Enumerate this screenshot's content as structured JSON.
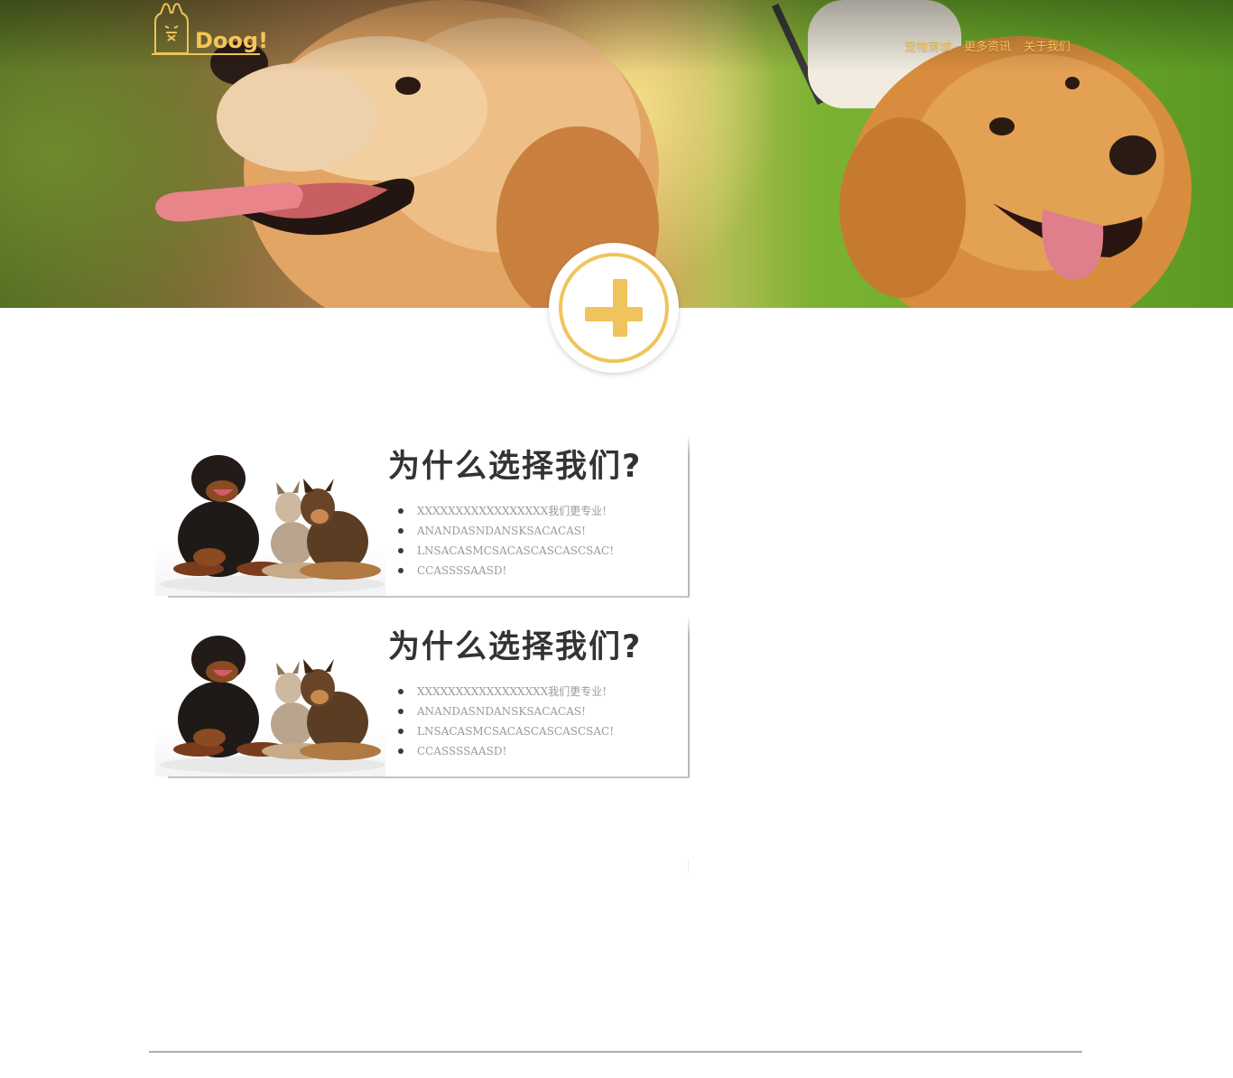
{
  "header": {
    "logo_text": "Doog!",
    "nav": [
      "宠物商城",
      "更多资讯",
      "关于我们"
    ]
  },
  "hero": {
    "image": "two-golden-retrievers-photo",
    "action_icon": "plus-icon"
  },
  "cards": [
    {
      "title": "为什么选择我们?",
      "image": "three-dogs-photo",
      "items": [
        "XXXXXXXXXXXXXXXXX我们更专业!",
        "ANANDASNDANSKSACACAS!",
        "LNSACASMCSACASCASCASCSAC!",
        "CCASSSSAASD!"
      ]
    },
    {
      "title": "为什么选择我们?",
      "image": "three-dogs-photo",
      "items": [
        "XXXXXXXXXXXXXXXXX我们更专业!",
        "ANANDASNDANSKSACACAS!",
        "LNSACASMCSACASCASCASCSAC!",
        "CCASSSSAASD!"
      ]
    }
  ],
  "colors": {
    "accent": "#f0c45c",
    "title_text": "#333333",
    "list_text": "#9a9a9a"
  }
}
